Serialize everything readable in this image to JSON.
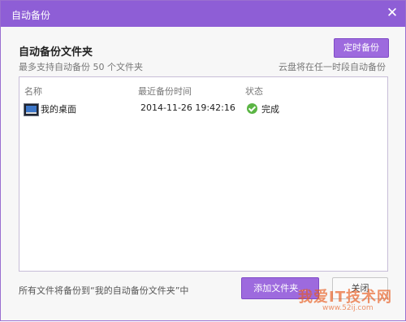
{
  "titlebar": {
    "title": "自动备份",
    "close_icon": "close-icon"
  },
  "section": {
    "title": "自动备份文件夹",
    "note": "最多支持自动备份 50 个文件夹",
    "schedule_button": "定时备份",
    "right_note": "云盘将在任一时段自动备份"
  },
  "table": {
    "headers": {
      "name": "名称",
      "time": "最近备份时间",
      "status": "状态"
    },
    "rows": [
      {
        "icon": "desktop-folder-icon",
        "name": "我的桌面",
        "time": "2014-11-26 19:42:16",
        "status_icon": "check-icon",
        "status": "完成"
      }
    ]
  },
  "footer": {
    "note": "所有文件将备份到“我的自动备份文件夹”中",
    "add_button": "添加文件夹...",
    "close_button": "关闭"
  },
  "watermark": {
    "text": "我爱IT技术网",
    "url": "www.52ij.com"
  },
  "colors": {
    "accent": "#8e5ed6",
    "success": "#5bb544"
  }
}
